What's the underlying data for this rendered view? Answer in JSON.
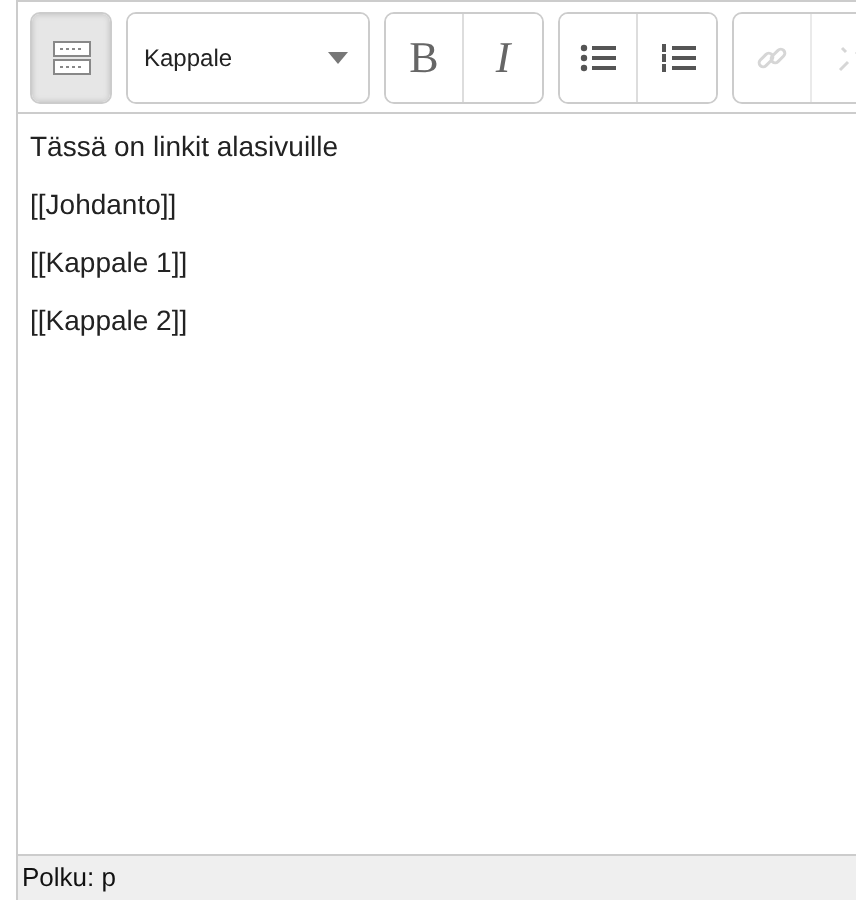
{
  "toolbar": {
    "groups": [
      {
        "buttons": [
          {
            "kind": "toggle",
            "pressed": true,
            "disabled": false
          }
        ]
      },
      {
        "buttons": [
          {
            "kind": "select",
            "value": "Kappale",
            "disabled": false
          }
        ]
      },
      {
        "buttons": [
          {
            "kind": "bold",
            "label": "B",
            "pressed": false,
            "disabled": false
          },
          {
            "kind": "italic",
            "label": "I",
            "pressed": false,
            "disabled": false
          }
        ]
      },
      {
        "buttons": [
          {
            "kind": "bullets",
            "pressed": false,
            "disabled": false
          },
          {
            "kind": "numbers",
            "pressed": false,
            "disabled": false
          }
        ]
      },
      {
        "buttons": [
          {
            "kind": "link",
            "pressed": false,
            "disabled": true
          },
          {
            "kind": "unlink",
            "pressed": false,
            "disabled": true
          }
        ]
      }
    ]
  },
  "content": {
    "paragraphs": [
      "Tässä on linkit alasivuille",
      "[[Johdanto]]",
      "[[Kappale 1]]",
      "[[Kappale 2]]"
    ]
  },
  "status_bar": {
    "path": "Polku: p"
  }
}
